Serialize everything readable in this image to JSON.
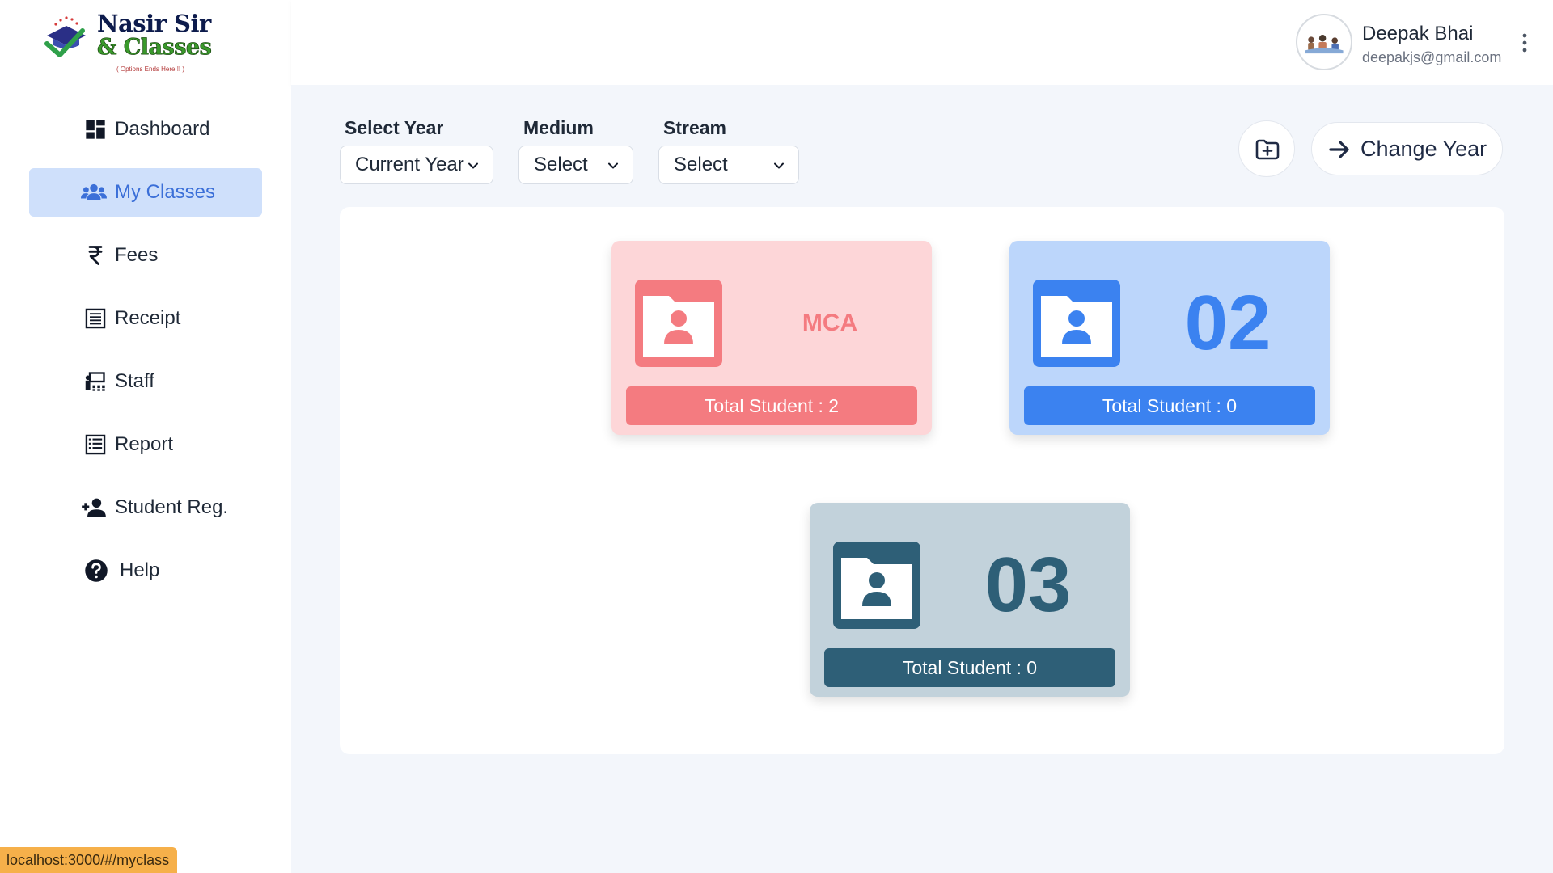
{
  "brand": {
    "line1": "Nasir Sir",
    "line2": "& Classes",
    "tagline": "( Options Ends Here!!! )"
  },
  "sidebar": {
    "items": [
      {
        "label": "Dashboard",
        "icon": "dashboard-icon",
        "active": false
      },
      {
        "label": "My Classes",
        "icon": "users-icon",
        "active": true
      },
      {
        "label": "Fees",
        "icon": "rupee-icon",
        "active": false
      },
      {
        "label": "Receipt",
        "icon": "receipt-icon",
        "active": false
      },
      {
        "label": "Staff",
        "icon": "staff-icon",
        "active": false
      },
      {
        "label": "Report",
        "icon": "report-icon",
        "active": false
      },
      {
        "label": "Student Reg.",
        "icon": "add-user-icon",
        "active": false
      },
      {
        "label": "Help",
        "icon": "help-icon",
        "active": false
      }
    ]
  },
  "header": {
    "user_name": "Deepak Bhai",
    "user_email": "deepakjs@gmail.com"
  },
  "filters": {
    "year": {
      "label": "Select Year",
      "value": "Current Year"
    },
    "medium": {
      "label": "Medium",
      "value": "Select"
    },
    "stream": {
      "label": "Stream",
      "value": "Select"
    }
  },
  "actions": {
    "change_year": "Change Year"
  },
  "classes": [
    {
      "name": "MCA",
      "total": "Total Student : 2",
      "bg": "#fdd6d8",
      "accent": "#f47b80"
    },
    {
      "name": "02",
      "total": "Total Student : 0",
      "bg": "#bcd6fb",
      "accent": "#3b82f0"
    },
    {
      "name": "03",
      "total": "Total Student : 0",
      "bg": "#c2d2db",
      "accent": "#2e5f77"
    }
  ],
  "status_bar": {
    "url": "localhost:3000/#/myclass"
  },
  "colors": {
    "active_nav_bg": "#cfe0fb",
    "active_nav_text": "#3b6fd8",
    "main_bg": "#f3f6fb",
    "status_bar_bg": "#f6b04a"
  }
}
